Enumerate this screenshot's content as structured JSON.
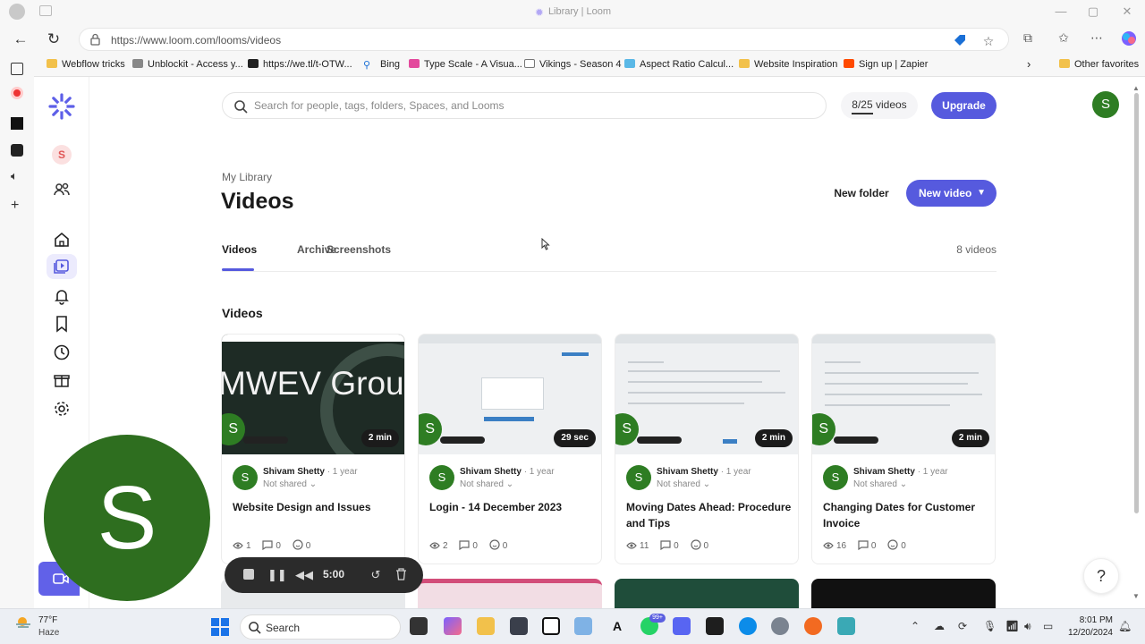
{
  "browser": {
    "window_title": "Library | Loom",
    "url": "https://www.loom.com/looms/videos",
    "bookmarks": [
      "Webflow tricks",
      "Unblockit - Access y...",
      "https://we.tl/t-OTW...",
      "Bing",
      "Type Scale - A Visua...",
      "Vikings - Season 4",
      "Aspect Ratio Calcul...",
      "Website Inspiration",
      "Sign up | Zapier"
    ],
    "other_favorites": "Other favorites"
  },
  "sidebar": {
    "workspace_initial": "S",
    "items": [
      "home-icon",
      "library-icon",
      "bell-icon",
      "bookmark-icon",
      "clock-icon",
      "gift-icon",
      "gear-icon"
    ]
  },
  "header": {
    "search_placeholder": "Search for people, tags, folders, Spaces, and Looms",
    "quota": "8/25 videos",
    "upgrade_label": "Upgrade",
    "user_initial": "S"
  },
  "library": {
    "breadcrumb": "My Library",
    "title": "Videos",
    "new_folder_label": "New folder",
    "new_video_label": "New video",
    "tabs": [
      "Videos",
      "Archive",
      "Screenshots"
    ],
    "count": "8 videos",
    "section_title": "Videos"
  },
  "videos": [
    {
      "thumb_text": "MWEV Group",
      "duration": "2 min",
      "author": "Shivam Shetty",
      "age": "· 1 year",
      "sharing": "Not shared",
      "title": "Website Design and Issues",
      "views": "1",
      "comments": "0",
      "reactions": "0"
    },
    {
      "thumb_text": "",
      "duration": "29 sec",
      "author": "Shivam Shetty",
      "age": "· 1 year",
      "sharing": "Not shared",
      "title": "Login - 14 December 2023",
      "views": "2",
      "comments": "0",
      "reactions": "0"
    },
    {
      "thumb_text": "",
      "duration": "2 min",
      "author": "Shivam Shetty",
      "age": "· 1 year",
      "sharing": "Not shared",
      "title": "Moving Dates Ahead: Procedure and Tips",
      "views": "11",
      "comments": "0",
      "reactions": "0"
    },
    {
      "thumb_text": "",
      "duration": "2 min",
      "author": "Shivam Shetty",
      "age": "· 1 year",
      "sharing": "Not shared",
      "title": "Changing Dates for Customer Invoice",
      "views": "16",
      "comments": "0",
      "reactions": "0"
    }
  ],
  "recorder": {
    "camera_initial": "S",
    "timer": "5:00"
  },
  "help_label": "?",
  "taskbar": {
    "temperature": "77°F",
    "condition": "Haze",
    "search_label": "Search",
    "notif_badge": "99+",
    "time": "8:01 PM",
    "date": "12/20/2024"
  },
  "colors": {
    "accent": "#565ade",
    "avatar_green": "#2e7d23"
  }
}
